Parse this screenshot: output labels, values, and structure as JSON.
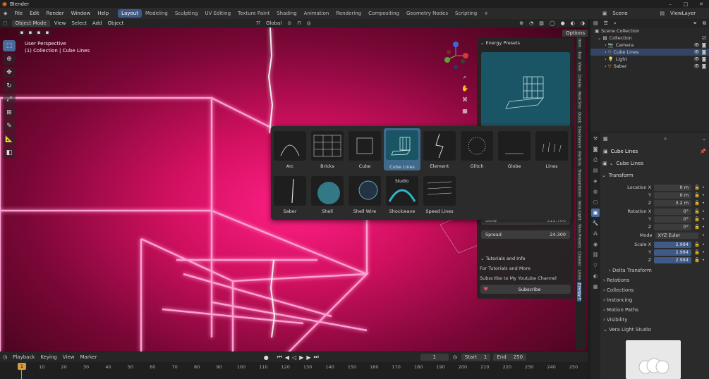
{
  "app": {
    "title": "Blender"
  },
  "menu": {
    "items": [
      "File",
      "Edit",
      "Render",
      "Window",
      "Help"
    ],
    "workspaces": [
      "Layout",
      "Modeling",
      "Sculpting",
      "UV Editing",
      "Texture Paint",
      "Shading",
      "Animation",
      "Rendering",
      "Compositing",
      "Geometry Nodes",
      "Scripting"
    ],
    "add_tab": "+",
    "scene_label": "Scene",
    "viewlayer_label": "ViewLayer"
  },
  "viewport_header": {
    "mode": "Object Mode",
    "menus": [
      "View",
      "Select",
      "Add",
      "Object"
    ],
    "transform": "Global",
    "options": "Options"
  },
  "viewport": {
    "perspective": "User Perspective",
    "collection_info": "(1) Collection | Cube Lines"
  },
  "n_panel": {
    "section_presets": "Energy Presets",
    "glow_label": "Glow",
    "glow_value": "315.700",
    "spread_label": "Spread",
    "spread_value": "24.300",
    "section_tutorials": "Tutorials and Info",
    "tutorials_text": "For Tutorials and More",
    "subscribe_text": "Subscribe to My Youtube Channel",
    "subscribe_button": "Subscribe",
    "tabs": [
      "Item",
      "Tool",
      "View",
      "Create",
      "Real Sno",
      "Quick",
      "Shockwave",
      "Particle",
      "Transportation",
      "Vera Light",
      "Vera Presets",
      "Creator",
      "Lines",
      "Energy F"
    ]
  },
  "popup": {
    "presets_row1": [
      "Arc",
      "Bricks",
      "Cube",
      "Cube Lines",
      "Element",
      "Glitch",
      "Globe",
      "Lines"
    ],
    "presets_row2": [
      "Saber",
      "Shell",
      "Shell Wire",
      "Shockwave",
      "Speed Lines"
    ],
    "selected": "Cube Lines",
    "tooltip": "Studio"
  },
  "outliner": {
    "root": "Scene Collection",
    "collection": "Collection",
    "objects": [
      "Camera",
      "Cube Lines",
      "Light",
      "Saber"
    ]
  },
  "properties": {
    "object_name": "Cube Lines",
    "data_name": "Cube Lines",
    "section_transform": "Transform",
    "location_label": "Location X",
    "location": [
      "0 m",
      "0 m",
      "3.2 m"
    ],
    "rotation_label": "Rotation X",
    "rotation": [
      "0°",
      "0°",
      "0°"
    ],
    "mode_label": "Mode",
    "mode_value": "XYZ Euler",
    "scale_label": "Scale X",
    "scale": [
      "2.984",
      "2.984",
      "2.984"
    ],
    "axis_y": "Y",
    "axis_z": "Z",
    "sections": [
      "Delta Transform",
      "Relations",
      "Collections",
      "Instancing",
      "Motion Paths",
      "Visibility",
      "Vera Light Studio"
    ]
  },
  "timeline": {
    "menus": [
      "Playback",
      "Keying",
      "View",
      "Marker"
    ],
    "current_frame": "1",
    "start_label": "Start",
    "start": "1",
    "end_label": "End",
    "end": "250",
    "ticks": [
      "1",
      "10",
      "20",
      "30",
      "40",
      "50",
      "60",
      "70",
      "80",
      "90",
      "100",
      "110",
      "120",
      "130",
      "140",
      "150",
      "160",
      "170",
      "180",
      "190",
      "200",
      "210",
      "220",
      "230",
      "240",
      "250"
    ]
  },
  "colors": {
    "accent": "#4b6a9c",
    "neon": "#ff5bb4",
    "background": "#d1105f"
  }
}
